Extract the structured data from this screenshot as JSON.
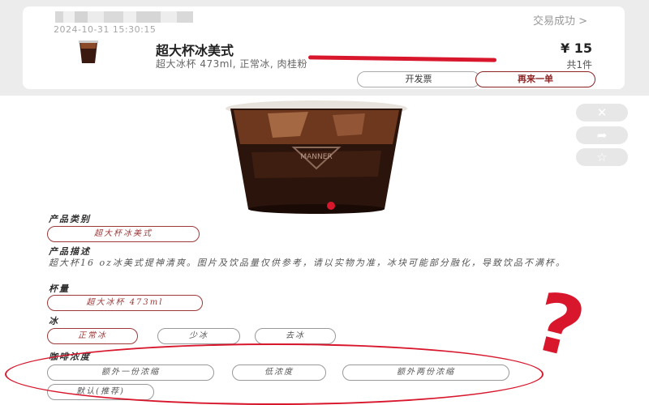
{
  "order": {
    "datetime": "2024-10-31 15:30:15",
    "status": "交易成功 >",
    "product_name": "超大杯冰美式",
    "product_spec": "超大冰杯 473ml, 正常冰, 肉桂粉",
    "price": "¥ 15",
    "quantity": "共1件",
    "invoice_button": "开发票",
    "reorder_button": "再来一单"
  },
  "product": {
    "brand": "MANNER",
    "category_title": "产品类别",
    "category_value": "超大杯冰美式",
    "description_title": "产品描述",
    "description_text": "超大杯16 oz冰美式提神清爽。图片及饮品量仅供参考，请以实物为准，冰块可能部分融化，导致饮品不满杯。",
    "cup_title": "杯量",
    "cup_value": "超大冰杯 473ml",
    "ice_title": "冰",
    "ice_options": [
      "正常冰",
      "少冰",
      "去冰"
    ],
    "strength_title": "咖啡浓度",
    "strength_options": [
      "额外一份浓缩",
      "低浓度",
      "额外两份浓缩",
      "默认(推荐)"
    ]
  },
  "side_icons": [
    "close-icon",
    "share-icon",
    "star-icon"
  ],
  "annotation": {
    "mark": "?",
    "color": "#d8172d"
  }
}
